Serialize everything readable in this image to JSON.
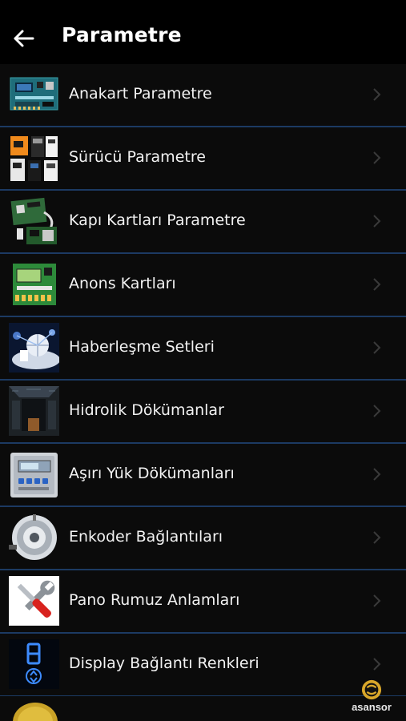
{
  "header": {
    "title": "Parametre",
    "back_icon": "arrow-left-icon"
  },
  "items": [
    {
      "label": "Anakart Parametre",
      "icon": "mainboard-icon"
    },
    {
      "label": "Sürücü Parametre",
      "icon": "drive-icon"
    },
    {
      "label": "Kapı Kartları Parametre",
      "icon": "door-card-icon"
    },
    {
      "label": "Anons Kartları",
      "icon": "announce-card-icon"
    },
    {
      "label": "Haberleşme Setleri",
      "icon": "communication-icon"
    },
    {
      "label": "Hidrolik Dökümanlar",
      "icon": "hydraulic-icon"
    },
    {
      "label": "Aşırı Yük Dökümanları",
      "icon": "overload-icon"
    },
    {
      "label": "Enkoder Bağlantıları",
      "icon": "encoder-icon"
    },
    {
      "label": "Pano Rumuz Anlamları",
      "icon": "tools-icon"
    },
    {
      "label": "Display Bağlantı Renkleri",
      "icon": "display-icon"
    }
  ],
  "brand": {
    "text": "asansor"
  },
  "colors": {
    "background": "#000000",
    "row": "#0b0b0b",
    "separator": "#1c3a63",
    "text": "#f2f2f2",
    "chevron": "#3a3a3a"
  }
}
